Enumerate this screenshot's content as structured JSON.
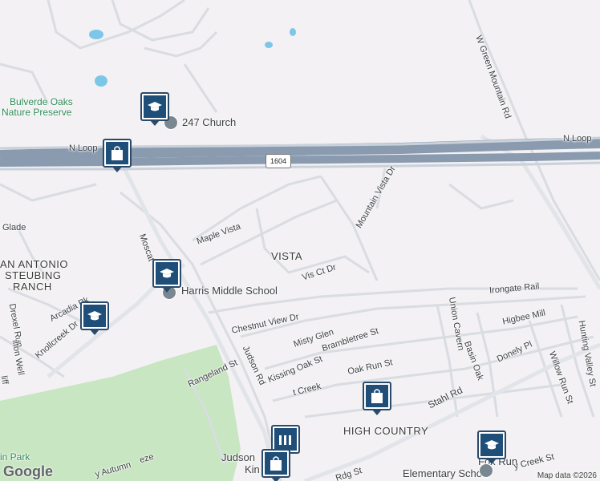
{
  "labels": {
    "bulverde_oaks_1": "Bulverde Oaks",
    "bulverde_oaks_2": "Nature Preserve",
    "church": "247 Church",
    "n_loop_left": "N Loop",
    "n_loop_right": "N Loop",
    "shield_1604": "1604",
    "glade": "Glade",
    "maple_vista": "Maple Vista",
    "san_antonio_1": "AN ANTONIO",
    "san_antonio_2": "STEUBING",
    "san_antonio_3": "RANCH",
    "moscat": "Moscat",
    "vista": "VISTA",
    "vis_ct_dr": "Vis Ct Dr",
    "mountain_vista_dr": "Mountain Vista Dr",
    "green_mountain_rd": "W Green Mountain Rd",
    "harris": "Harris Middle School",
    "arcadia": "Arcadia Pk",
    "knollcreek": "Knollcreek Dr",
    "drexel": "Drexel Run",
    "hilton_well": "ilton Well",
    "cliff": "liff",
    "irongate": "Irongate Rail",
    "chestnut": "Chestnut View Dr",
    "union_cavern": "Union Cavern",
    "highee_mill": "Higbee Mill",
    "hunting_valley": "Hunting Valley St",
    "misty_glen": "Misty Glen",
    "brambletree": "Brambletree St",
    "basin_oak": "Basin Oak",
    "donely": "Donely Pl",
    "judson_rd": "Judson Rd",
    "kissing_oak": "Kissing Oak St",
    "oak_run": "Oak Run St",
    "willow_run": "Willow Run St",
    "rangeland": "Rangeland St",
    "creek": "t Creek",
    "stahl": "Stahl Rd",
    "high_country": "HIGH COUNTRY",
    "judson": "Judson",
    "kin": "Kin",
    "fox_run_1": "Fox Run",
    "fox_run_2": "Elementary School",
    "in_park": "in Park",
    "autumn": "y Autumn",
    "eze": "eze",
    "rdg": "Rdg St",
    "y_creek": "y Creek St"
  },
  "pins": {
    "school_top": "school-icon",
    "shopping_nloop": "shopping-bag-icon",
    "school_harris": "school-icon",
    "school_knollcreek": "school-icon",
    "shopping_highcountry": "shopping-bag-icon",
    "school_foxrun": "school-icon",
    "shopping_judson": "shopping-bag-icon"
  },
  "footer": {
    "logo": "Google",
    "attribution": "Map data ©2026"
  },
  "colors": {
    "highway": "#8a9bb0",
    "park": "#c8e6c1",
    "water": "#7cc6e8",
    "pin": "#1f4e79"
  }
}
